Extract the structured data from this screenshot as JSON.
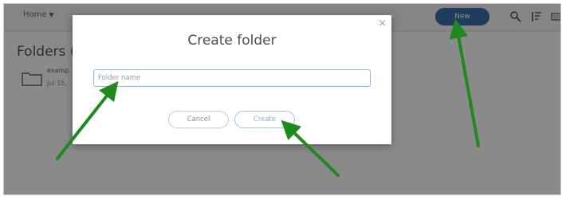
{
  "header": {
    "home_label": "Home",
    "new_button_label": "New",
    "icons": [
      "search-icon",
      "sort-icon",
      "keyboard-icon"
    ]
  },
  "page": {
    "heading": "Folders (",
    "folder": {
      "name": "examp",
      "date": "Jul 15,"
    }
  },
  "dialog": {
    "title": "Create folder",
    "close_glyph": "×",
    "input": {
      "value": "",
      "placeholder": "Folder name"
    },
    "cancel_label": "Cancel",
    "create_label": "Create"
  },
  "annotations": {
    "arrow_color": "#1e8a1e"
  },
  "colors": {
    "accent": "#3a6ea8",
    "input_border": "#8fb3d9"
  }
}
